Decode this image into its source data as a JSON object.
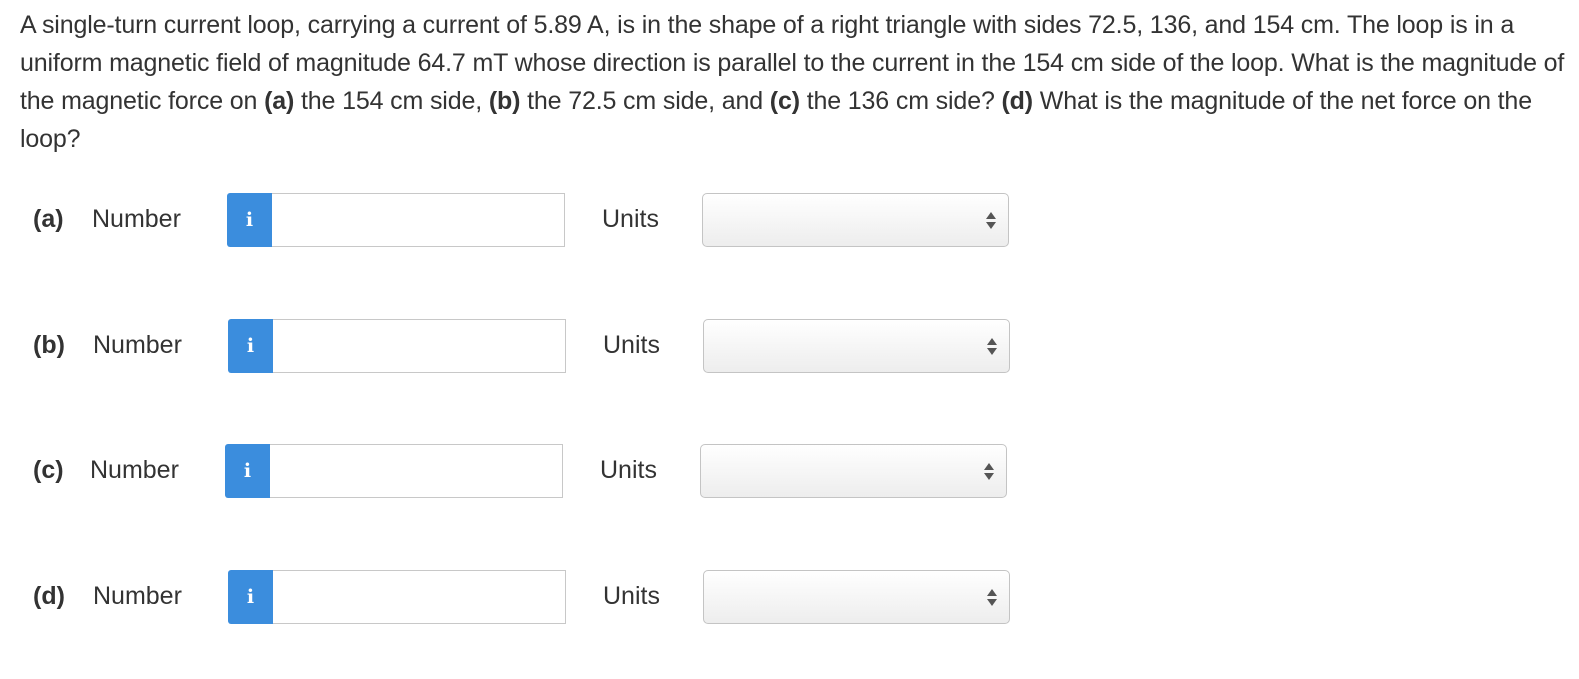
{
  "question": {
    "segments": [
      {
        "text": "A single-turn current loop, carrying a current of 5.89 A, is in the shape of a right triangle with sides 72.5, 136, and 154 cm. The loop is in a uniform magnetic field of magnitude 64.7 mT whose direction is parallel to the current in the 154 cm side of the loop. What is the magnitude of the magnetic force on ",
        "bold": false
      },
      {
        "text": "(a)",
        "bold": true
      },
      {
        "text": " the 154 cm side, ",
        "bold": false
      },
      {
        "text": "(b)",
        "bold": true
      },
      {
        "text": " the 72.5 cm side, and ",
        "bold": false
      },
      {
        "text": "(c)",
        "bold": true
      },
      {
        "text": " the 136 cm side? ",
        "bold": false
      },
      {
        "text": "(d)",
        "bold": true
      },
      {
        "text": " What is the magnitude of the net force on the loop?",
        "bold": false
      }
    ]
  },
  "parts": [
    {
      "label": "(a)",
      "number_label": "Number",
      "info_icon": "i",
      "value": "",
      "units_label": "Units",
      "units_value": ""
    },
    {
      "label": "(b)",
      "number_label": "Number",
      "info_icon": "i",
      "value": "",
      "units_label": "Units",
      "units_value": ""
    },
    {
      "label": "(c)",
      "number_label": "Number",
      "info_icon": "i",
      "value": "",
      "units_label": "Units",
      "units_value": ""
    },
    {
      "label": "(d)",
      "number_label": "Number",
      "info_icon": "i",
      "value": "",
      "units_label": "Units",
      "units_value": ""
    }
  ],
  "colors": {
    "info_button": "#3b8ddd",
    "text": "#333333",
    "input_border": "#c8c8c8"
  },
  "icons": {
    "info": "info-icon",
    "select_arrows": "up-down-arrows-icon"
  }
}
